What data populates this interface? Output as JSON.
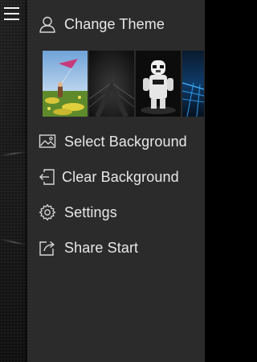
{
  "menu": {
    "items": [
      {
        "label": "Change Theme",
        "icon": "person-icon"
      },
      {
        "label": "Select Background",
        "icon": "picture-icon"
      },
      {
        "label": "Clear Background",
        "icon": "exit-icon"
      },
      {
        "label": "Settings",
        "icon": "gear-icon"
      },
      {
        "label": "Share Start",
        "icon": "share-icon"
      }
    ]
  },
  "themes": [
    {
      "name": "kite-field-theme"
    },
    {
      "name": "dark-metal-theme"
    },
    {
      "name": "stormtrooper-theme"
    },
    {
      "name": "blue-grid-theme"
    }
  ],
  "colors": {
    "panel": "#2b2b2b",
    "rail": "#151515",
    "text": "#e8e8e8",
    "icon_stroke": "#d8d8d8"
  }
}
